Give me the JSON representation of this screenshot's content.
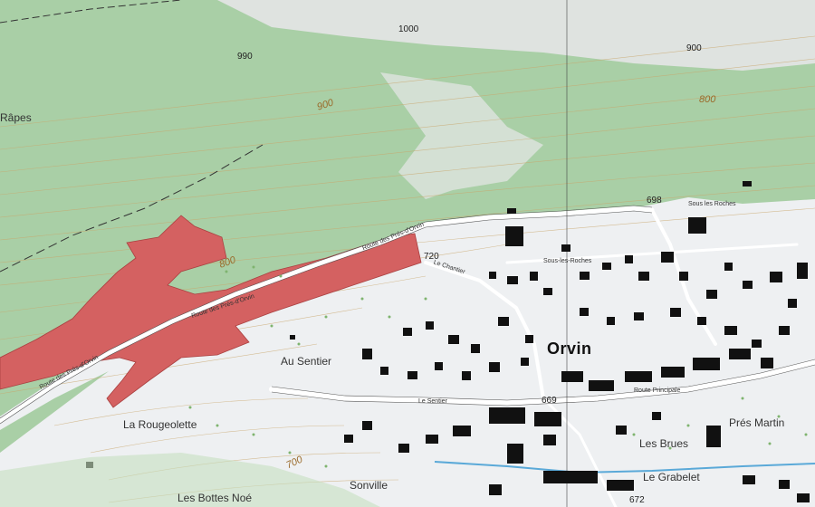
{
  "map": {
    "town": "Orvin",
    "colors": {
      "forest": "#a9cfa6",
      "open_land": "#eef0f2",
      "hazard_zone": "#d46161",
      "building": "#111111",
      "contour": "#c9a66b",
      "road": "#ffffff",
      "water": "#5aa9d8"
    },
    "places": [
      {
        "name": "Râpes"
      },
      {
        "name": "Au Sentier"
      },
      {
        "name": "La Rougeolette"
      },
      {
        "name": "Les Bottes Noé"
      },
      {
        "name": "Sonville"
      },
      {
        "name": "Les Brues"
      },
      {
        "name": "Le Grabelet"
      },
      {
        "name": "Prés Martin"
      }
    ],
    "spot_heights": [
      "990",
      "1000",
      "900",
      "720",
      "698",
      "669",
      "672"
    ],
    "contour_labels": [
      "900",
      "800",
      "800",
      "700"
    ],
    "roads": [
      "Route des Prés-d'Orvin",
      "Route des Prés-d'Orvin",
      "Route des Prés-d'Orvin",
      "Sous les Roches",
      "Le Chantier",
      "Le Sentier",
      "Route Principale",
      "Sous-les-Roches"
    ]
  }
}
